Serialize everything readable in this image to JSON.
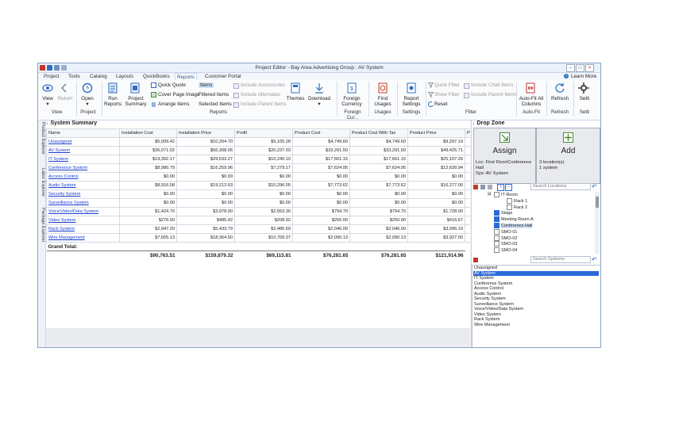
{
  "window": {
    "title": "Project Editor - Bay Area Advertising Group : AV System",
    "learn_more": "Learn More"
  },
  "menu_tabs": [
    "Project",
    "Tools",
    "Catalog",
    "Layouts",
    "QuickBooks",
    "Reports",
    "Customer Portal"
  ],
  "ribbon": {
    "view": {
      "view": "View",
      "return": "Return",
      "group": "View"
    },
    "project": {
      "open": "Open",
      "group": "Project"
    },
    "reports": {
      "run_reports": "Run Reports",
      "project_summary": "Project Summary",
      "quick_quote": "Quick Quote",
      "cover_page_image": "Cover Page Image",
      "arrange_items": "Arrange Items",
      "items": "Items",
      "filtered_items": "Filtered Items",
      "selected_items": "Selected Items",
      "include_accessories": "Include Accessories",
      "include_alternates": "Include Alternates",
      "include_parent_items": "Include Parent Items",
      "themes": "Themes",
      "download": "Download",
      "group": "Reports"
    },
    "foreign_currency": {
      "label": "Foreign Currency",
      "group": "Foreign Cur..."
    },
    "usages": {
      "find_usages": "Find Usages",
      "group": "Usages"
    },
    "settings": {
      "report_settings": "Report Settings",
      "group": "Settings"
    },
    "filter": {
      "quick_filter": "Quick Filter",
      "show_filter": "Show Filter",
      "reset": "Reset",
      "include_child_items": "Include Child Items",
      "include_parent_items": "Include Parent Items",
      "group": "Filter"
    },
    "autofit": {
      "label": "Auto-Fit All Columns",
      "group": "Auto-Fit"
    },
    "refresh": {
      "label": "Refresh",
      "group": "Refresh"
    },
    "settings2": {
      "label": "Setti",
      "group": "Setti"
    }
  },
  "side_tabs": [
    "Product Explorer",
    "Labor Explorer",
    "Package Explorer"
  ],
  "summary": {
    "title": "System Summary",
    "columns": [
      "Name",
      "Installation Cost",
      "Installation Price",
      "Profit",
      "Product Cost",
      "Product Cost With Tax",
      "Product Price",
      "P"
    ],
    "rows": [
      [
        "Unassigned",
        "$5,099.42",
        "$10,204.70",
        "$5,105.28",
        "$4,749.60",
        "$4,749.60",
        "$9,297.19"
      ],
      [
        "AV System",
        "$36,071.02",
        "$56,308.05",
        "$20,237.03",
        "$33,291.50",
        "$33,291.50",
        "$49,425.71"
      ],
      [
        "IT System",
        "$19,392.17",
        "$29,632.27",
        "$10,240.10",
        "$17,661.15",
        "$17,661.15",
        "$25,107.26"
      ],
      [
        "Conference System",
        "$8,980.79",
        "$16,259.96",
        "$7,279.17",
        "$7,624.95",
        "$7,624.95",
        "$12,639.94"
      ],
      [
        "Access Control",
        "$0.00",
        "$0.00",
        "$0.00",
        "$0.00",
        "$0.00",
        "$0.00"
      ],
      [
        "Audio System",
        "$8,916.58",
        "$19,212.63",
        "$10,296.05",
        "$7,773.62",
        "$7,773.62",
        "$16,277.00"
      ],
      [
        "Security System",
        "$0.00",
        "$0.00",
        "$0.00",
        "$0.00",
        "$0.00",
        "$0.00"
      ],
      [
        "Surveillance System",
        "$0.00",
        "$0.00",
        "$0.00",
        "$0.00",
        "$0.00",
        "$0.00"
      ],
      [
        "Voice/Video/Data System",
        "$1,424.70",
        "$3,978.00",
        "$2,553.30",
        "$794.70",
        "$794.70",
        "$1,728.00"
      ],
      [
        "Video System",
        "$276.50",
        "$485.42",
        "$208.92",
        "$250.00",
        "$250.00",
        "$416.67"
      ],
      [
        "Rack System",
        "$2,947.20",
        "$5,433.79",
        "$2,486.59",
        "$2,046.00",
        "$2,046.00",
        "$3,096.19"
      ],
      [
        "Wire Management",
        "$7,655.13",
        "$18,364.50",
        "$10,709.37",
        "$2,090.13",
        "$2,090.13",
        "$3,927.00"
      ]
    ],
    "grand_total_label": "Grand Total:",
    "grand_totals": [
      "$90,763.51",
      "$159,879.32",
      "$69,115.81",
      "$76,281.65",
      "$76,281.65",
      "$121,914.96"
    ]
  },
  "dropzone": {
    "title": "Drop Zone",
    "assign": "Assign",
    "add": "Add",
    "loc_line1": "Loc: First Floor\\Conference",
    "loc_line2": "Hall",
    "sys_line": "Sys: AV System",
    "count_line1": "3 location(s)",
    "count_line2": "1 system",
    "search_locations": "Search Locations",
    "search_systems": "Search Systems",
    "tree": [
      {
        "label": "IT Room",
        "checked": false,
        "indent": 1
      },
      {
        "label": "Rack 1",
        "checked": false,
        "indent": 2
      },
      {
        "label": "Rack 2",
        "checked": false,
        "indent": 2
      },
      {
        "label": "Stage",
        "checked": true,
        "indent": 1
      },
      {
        "label": "Meeting Room A",
        "checked": true,
        "indent": 1
      },
      {
        "label": "Conference Hall",
        "checked": true,
        "indent": 1
      },
      {
        "label": "SMO-01",
        "checked": false,
        "indent": 1
      },
      {
        "label": "SMO-02",
        "checked": false,
        "indent": 1
      },
      {
        "label": "SMO-03",
        "checked": false,
        "indent": 1
      },
      {
        "label": "SMO-04",
        "checked": false,
        "indent": 1
      }
    ],
    "systems": [
      "Unassigned",
      "AV System",
      "IT System",
      "Conference System",
      "Access Control",
      "Audio System",
      "Security System",
      "Surveillance System",
      "Voice/Video/Data System",
      "Video System",
      "Rack System",
      "Wire Management"
    ],
    "selected_system": "AV System"
  },
  "colors": {
    "accent": "#2a6ad6",
    "link": "#1a3ecf",
    "frame": "#8aa4c8"
  }
}
